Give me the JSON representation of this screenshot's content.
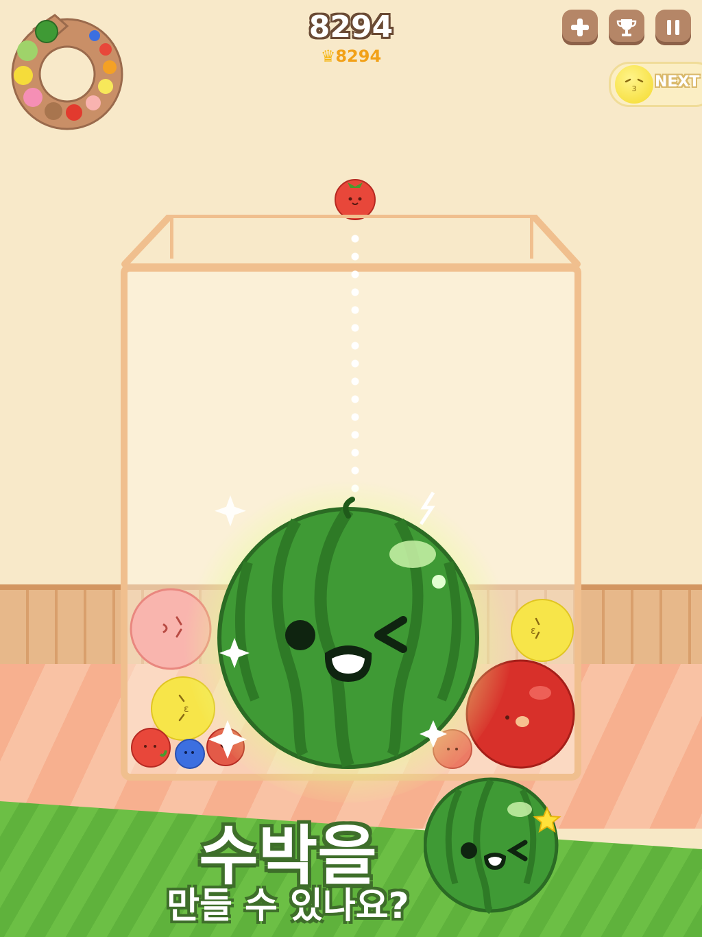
{
  "hud": {
    "score": "8294",
    "best_score": "8294",
    "crown_icon": "crown-icon",
    "buttons": [
      {
        "name": "add-button",
        "icon": "plus-icon"
      },
      {
        "name": "leaderboard-button",
        "icon": "trophy-icon"
      },
      {
        "name": "pause-button",
        "icon": "pause-icon"
      }
    ],
    "next_label": "NEXT",
    "next_fruit": "lemon"
  },
  "current_fruit": "strawberry",
  "promo": {
    "title": "수박을",
    "subtitle": "만들 수 있나요?"
  },
  "colors": {
    "watermelon": "#3f9a35",
    "strawberry": "#e8473a",
    "lemon": "#f4da2d",
    "peach": "#f7a3a0",
    "apple": "#d8302a",
    "blueberry": "#3c6fe0",
    "box_border": "#f0bf8e"
  }
}
